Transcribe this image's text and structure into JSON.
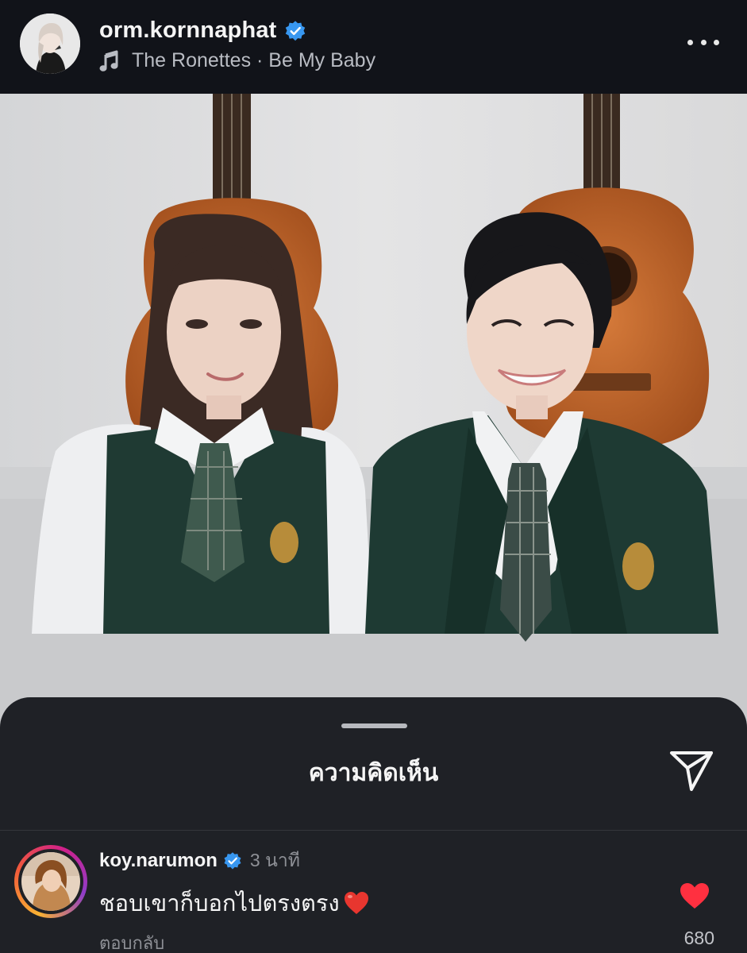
{
  "post": {
    "username": "orm.kornnaphat",
    "verified": true,
    "music": {
      "label": "The Ronettes · Be My Baby",
      "icon": "music-note-icon"
    },
    "more_icon": "more-options-icon"
  },
  "comments_sheet": {
    "title": "ความคิดเห็น",
    "share_icon": "send-icon"
  },
  "comment": {
    "username": "koy.narumon",
    "verified": true,
    "time": "3 นาที",
    "text": "ชอบเขาก็บอกไปตรงตรง",
    "emoji": "red-heart-emoji",
    "reply_label": "ตอบกลับ",
    "like_count": "680",
    "like_icon": "heart-filled-icon",
    "like_color": "#ff3040"
  },
  "colors": {
    "header_bg": "#111319",
    "sheet_bg": "#1f2126",
    "verified_blue": "#3897f0",
    "text_primary": "#f5f5f5",
    "text_secondary": "#8e9096"
  }
}
